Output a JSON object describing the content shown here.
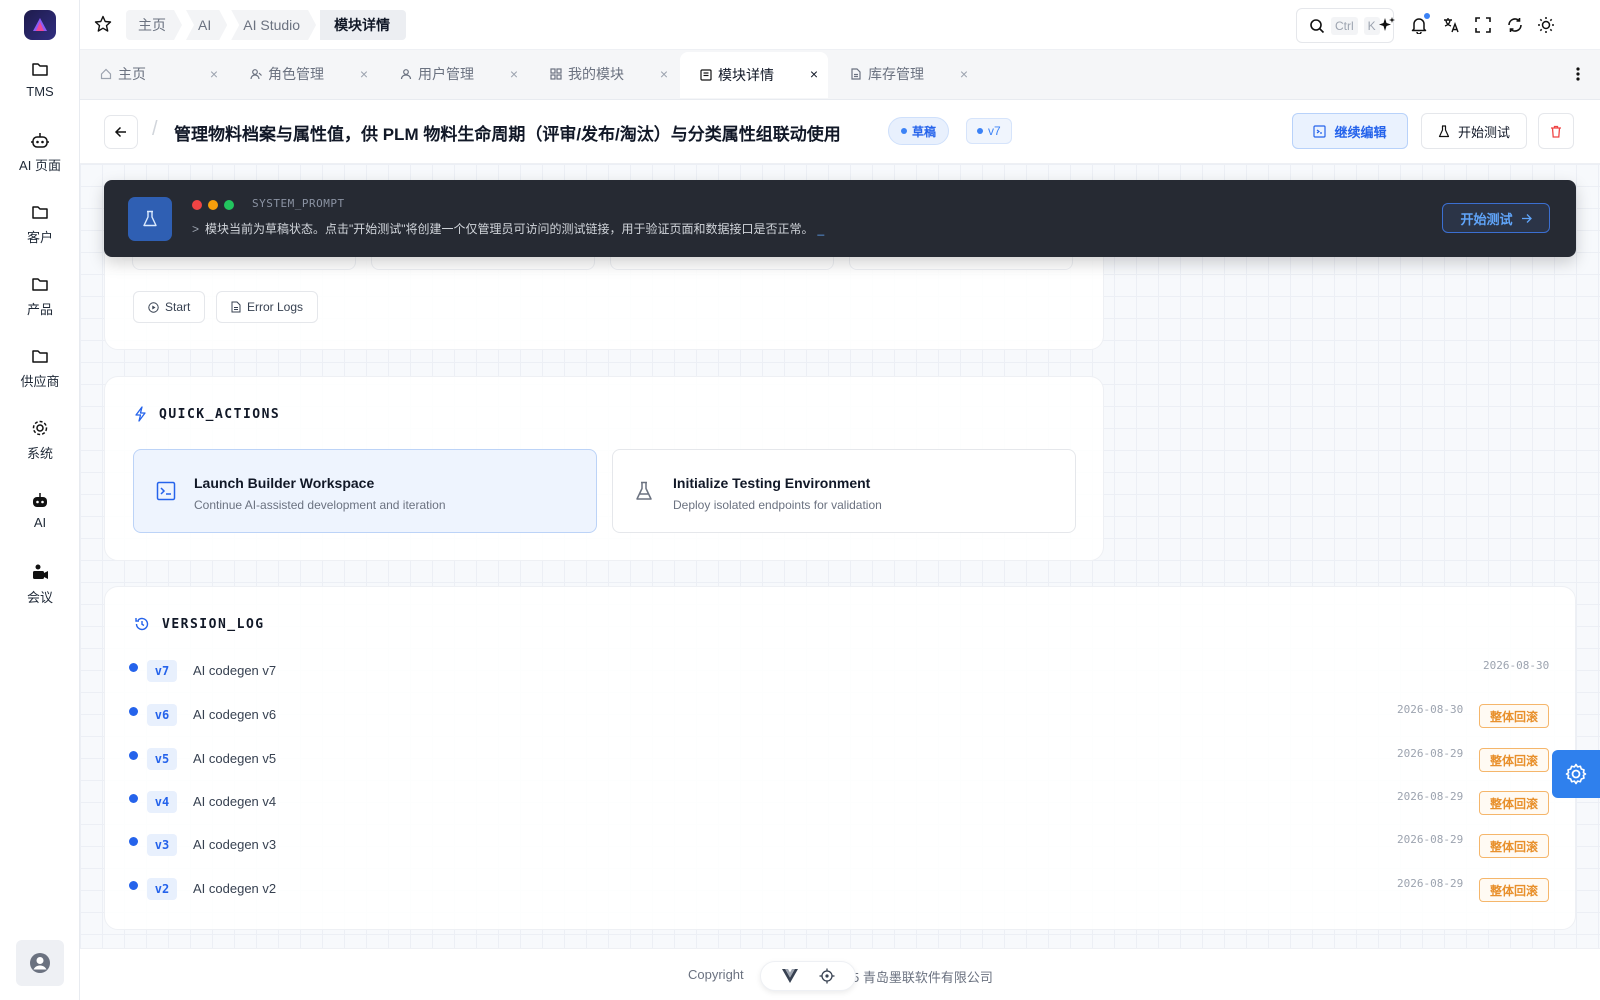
{
  "sidebar": {
    "items": [
      {
        "label": "TMS",
        "icon": "folder-icon"
      },
      {
        "label": "AI 页面",
        "icon": "robot-icon"
      },
      {
        "label": "客户",
        "icon": "folder-icon"
      },
      {
        "label": "产品",
        "icon": "folder-icon"
      },
      {
        "label": "供应商",
        "icon": "folder-icon"
      },
      {
        "label": "系统",
        "icon": "gear-icon"
      },
      {
        "label": "AI",
        "icon": "robot-icon"
      },
      {
        "label": "会议",
        "icon": "meeting-icon"
      }
    ]
  },
  "header": {
    "breadcrumb": [
      "主页",
      "AI",
      "AI Studio",
      "模块详情"
    ],
    "search": {
      "kbd1": "Ctrl",
      "kbd2": "K"
    }
  },
  "tabs": [
    {
      "label": "主页",
      "icon": "home-icon"
    },
    {
      "label": "角色管理",
      "icon": "roles-icon"
    },
    {
      "label": "用户管理",
      "icon": "user-icon"
    },
    {
      "label": "我的模块",
      "icon": "grid-icon"
    },
    {
      "label": "模块详情",
      "icon": "detail-icon",
      "active": true
    },
    {
      "label": "库存管理",
      "icon": "file-icon"
    }
  ],
  "page": {
    "title": "管理物料档案与属性值，供 PLM 物料生命周期（评审/发布/淘汰）与分类属性组联动使用",
    "status_chip": "草稿",
    "version_chip": "v7",
    "continue_label": "继续编辑",
    "test_label": "开始测试"
  },
  "terminal": {
    "label": "SYSTEM_PROMPT",
    "text": "模块当前为草稿状态。点击\"开始测试\"将创建一个仅管理员可访问的测试链接，用于验证页面和数据接口是否正常。",
    "cursor": "_",
    "button": "开始测试"
  },
  "runtime": {
    "start_label": "Start",
    "logs_label": "Error Logs"
  },
  "quick_actions": {
    "title": "QUICK_ACTIONS",
    "items": [
      {
        "title": "Launch Builder Workspace",
        "desc": "Continue AI-assisted development and iteration"
      },
      {
        "title": "Initialize Testing Environment",
        "desc": "Deploy isolated endpoints for validation"
      }
    ]
  },
  "version_log": {
    "title": "VERSION_LOG",
    "rollback_label": "整体回滚",
    "entries": [
      {
        "tag": "v7",
        "name": "AI codegen v7",
        "date": "2026-08-30"
      },
      {
        "tag": "v6",
        "name": "AI codegen v6",
        "date": "2026-08-30"
      },
      {
        "tag": "v5",
        "name": "AI codegen v5",
        "date": "2026-08-29"
      },
      {
        "tag": "v4",
        "name": "AI codegen v4",
        "date": "2026-08-29"
      },
      {
        "tag": "v3",
        "name": "AI codegen v3",
        "date": "2026-08-29"
      },
      {
        "tag": "v2",
        "name": "AI codegen v2",
        "date": "2026-08-29"
      }
    ]
  },
  "footer": {
    "copyright": "Copyright",
    "company": "5  青岛墨联软件有限公司"
  },
  "colors": {
    "accent": "#2563eb",
    "rollback": "#e8902c",
    "terminal_bg": "#262a33"
  }
}
